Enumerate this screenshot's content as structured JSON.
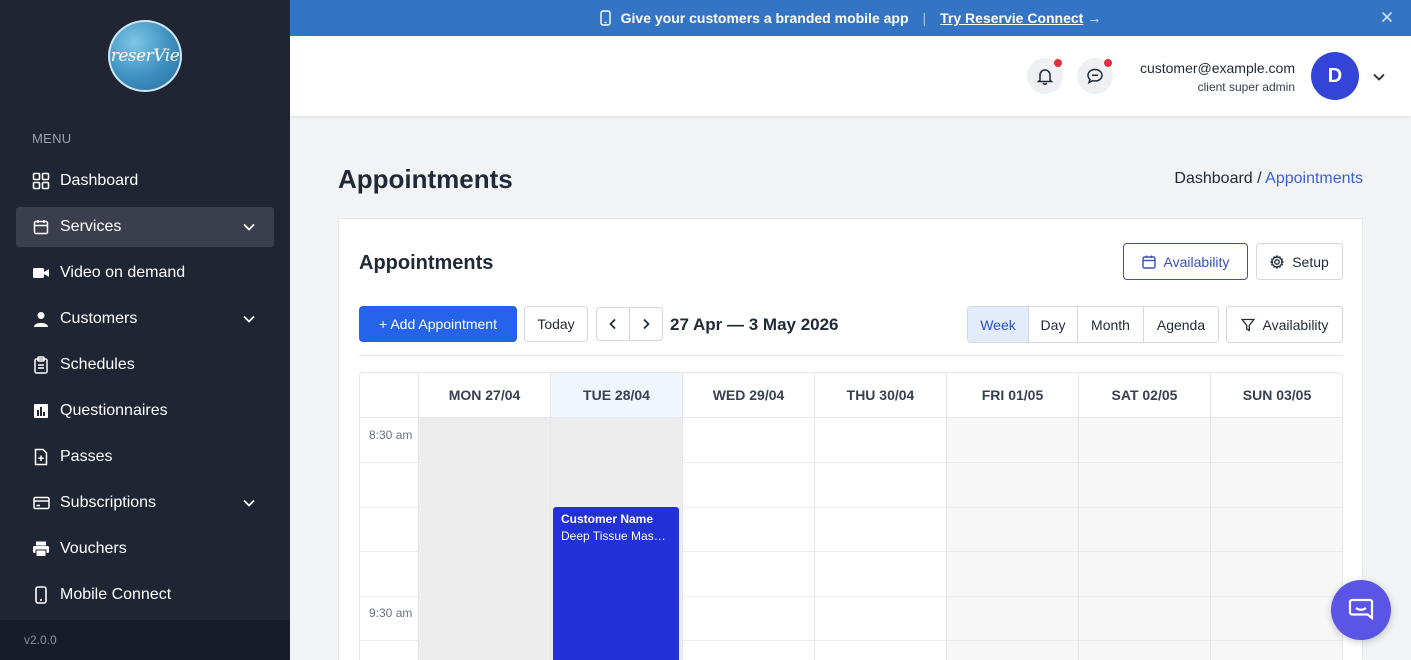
{
  "sidebar": {
    "logo_text": "reserVie",
    "menu_label": "MENU",
    "items": [
      {
        "label": "Dashboard",
        "icon": "grid-icon"
      },
      {
        "label": "Services",
        "icon": "calendar-icon"
      },
      {
        "label": "Video on demand",
        "icon": "video-icon"
      },
      {
        "label": "Customers",
        "icon": "user-icon"
      },
      {
        "label": "Schedules",
        "icon": "clipboard-icon"
      },
      {
        "label": "Questionnaires",
        "icon": "bar-chart-icon"
      },
      {
        "label": "Passes",
        "icon": "file-plus-icon"
      },
      {
        "label": "Subscriptions",
        "icon": "credit-card-icon"
      },
      {
        "label": "Vouchers",
        "icon": "printer-icon"
      },
      {
        "label": "Mobile Connect",
        "icon": "smartphone-icon"
      }
    ],
    "version": "v2.0.0"
  },
  "promo": {
    "text": "Give your customers a branded mobile app",
    "separator": "|",
    "link": "Try Reservie Connect",
    "arrow": "→"
  },
  "header": {
    "email": "customer@example.com",
    "role": "client super admin",
    "avatar_initial": "D"
  },
  "page": {
    "title": "Appointments",
    "breadcrumb_home": "Dashboard /",
    "breadcrumb_current": "Appointments"
  },
  "card": {
    "title": "Appointments",
    "availability_label": "Availability",
    "setup_label": "Setup",
    "add_label": "+ Add Appointment",
    "today_label": "Today",
    "date_range": "27 Apr — 3 May 2026",
    "views": [
      "Week",
      "Day",
      "Month",
      "Agenda"
    ],
    "active_view": "Week",
    "filter_label": "Availability"
  },
  "calendar": {
    "days": [
      "MON 27/04",
      "TUE 28/04",
      "WED 29/04",
      "THU 30/04",
      "FRI 01/05",
      "SAT 02/05",
      "SUN 03/05"
    ],
    "times": [
      "8:30 am",
      "9:30 am"
    ],
    "event": {
      "name": "Customer Name",
      "service": "Deep Tissue Massa..."
    }
  },
  "colors": {
    "sidebar_bg": "#1f2533",
    "promo_bg": "#3474c4",
    "primary": "#2563eb",
    "event": "#2231d8",
    "avatar": "#3344d6",
    "chat_fab": "#5b55e6",
    "notification_dot": "#e0303e"
  }
}
